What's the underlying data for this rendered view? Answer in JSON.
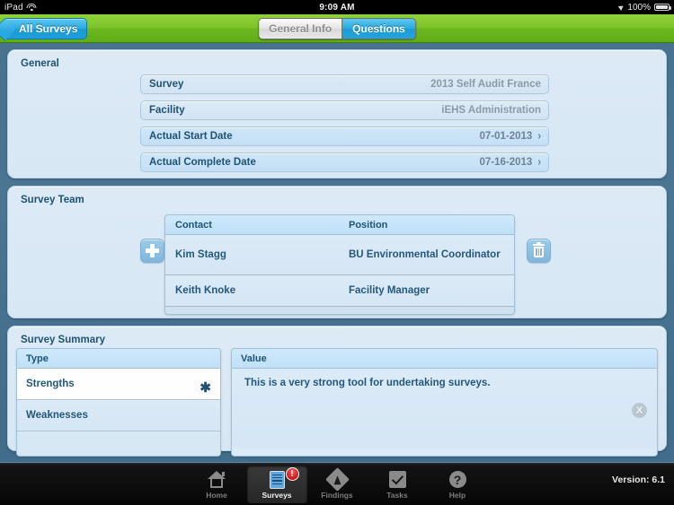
{
  "status_bar": {
    "device": "iPad",
    "wifi_icon": "wifi-icon",
    "time": "9:09 AM",
    "location_icon": "location-arrow-icon",
    "battery_percent": "100%",
    "battery_icon": "battery-icon"
  },
  "nav_bar": {
    "back_label": "All Surveys",
    "segments": [
      {
        "label": "General Info",
        "active": false
      },
      {
        "label": "Questions",
        "active": true
      }
    ]
  },
  "general": {
    "title": "General",
    "fields": [
      {
        "label": "Survey",
        "value": "2013 Self Audit France",
        "tappable": false
      },
      {
        "label": "Facility",
        "value": "iEHS Administration",
        "tappable": false
      },
      {
        "label": "Actual Start Date",
        "value": "07-01-2013",
        "tappable": true
      },
      {
        "label": "Actual Complete Date",
        "value": "07-16-2013",
        "tappable": true
      }
    ],
    "chevron": "›"
  },
  "survey_team": {
    "title": "Survey Team",
    "add_button": "+",
    "delete_button": "trash",
    "columns": [
      "Contact",
      "Position"
    ],
    "rows": [
      {
        "contact": "Kim Stagg",
        "position": "BU Environmental Coordinator"
      },
      {
        "contact": "Keith Knoke",
        "position": "Facility Manager"
      }
    ]
  },
  "survey_summary": {
    "title": "Survey Summary",
    "type_header": "Type",
    "value_header": "Value",
    "types": [
      {
        "label": "Strengths",
        "selected": true,
        "marker": "✱"
      },
      {
        "label": "Weaknesses",
        "selected": false,
        "marker": ""
      }
    ],
    "value_text": "This is a very strong tool for undertaking surveys.",
    "clear_button": "X"
  },
  "tab_bar": {
    "tabs": [
      {
        "label": "Home",
        "icon": "home-icon",
        "active": false,
        "badge": ""
      },
      {
        "label": "Surveys",
        "icon": "surveys-icon",
        "active": true,
        "badge": "!"
      },
      {
        "label": "Findings",
        "icon": "findings-icon",
        "active": false,
        "badge": ""
      },
      {
        "label": "Tasks",
        "icon": "tasks-icon",
        "active": false,
        "badge": ""
      },
      {
        "label": "Help",
        "icon": "help-icon",
        "active": false,
        "badge": ""
      }
    ],
    "version": "Version: 6.1"
  },
  "colors": {
    "nav_green": "#6cb81f",
    "accent_blue": "#28a9e1",
    "panel_bg": "#dceaf6",
    "page_bg": "#46718f",
    "label_blue": "#1f5274",
    "badge_red": "#c00000"
  }
}
